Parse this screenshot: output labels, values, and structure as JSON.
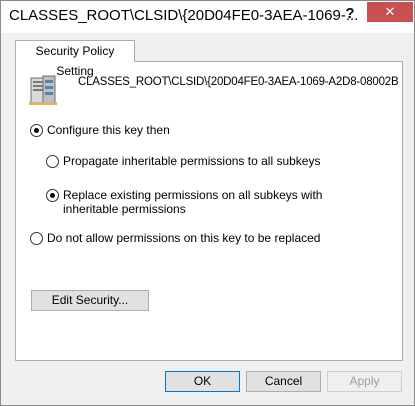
{
  "window": {
    "title": "CLASSES_ROOT\\CLSID\\{20D04FE0-3AEA-1069-...",
    "help_label": "?",
    "close_label": "✕"
  },
  "tabs": [
    {
      "label": "Security Policy Setting",
      "selected": true
    }
  ],
  "policy": {
    "key_path": "CLASSES_ROOT\\CLSID\\{20D04FE0-3AEA-1069-A2D8-08002B",
    "icon": "registry-server-icon",
    "options": {
      "configure": {
        "label": "Configure this key then",
        "checked": true
      },
      "propagate": {
        "label": "Propagate inheritable permissions to all subkeys",
        "checked": false
      },
      "replace": {
        "label": "Replace existing permissions on all subkeys with inheritable permissions",
        "checked": true
      },
      "do_not_allow": {
        "label": "Do not allow permissions on this key to be replaced",
        "checked": false
      }
    },
    "edit_security_label": "Edit Security..."
  },
  "footer": {
    "ok_label": "OK",
    "cancel_label": "Cancel",
    "apply_label": "Apply"
  }
}
